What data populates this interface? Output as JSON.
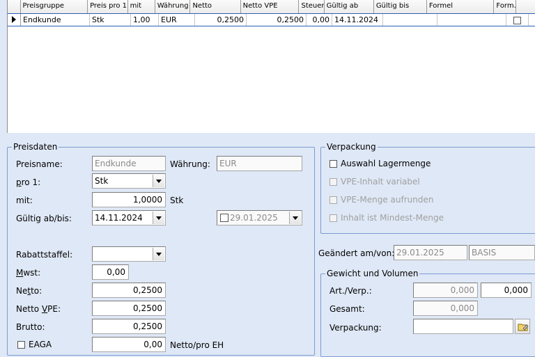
{
  "grid": {
    "headers": [
      "Preisgruppe",
      "Preis pro 1",
      "mit",
      "Währung",
      "Netto",
      "Netto VPE",
      "Steuer",
      "Gültig ab",
      "Gültig bis",
      "Formel",
      "Form."
    ],
    "row": {
      "preisgruppe": "Endkunde",
      "preis_pro": "Stk",
      "mit": "1,00",
      "waehrung": "EUR",
      "netto": "0,2500",
      "netto_vpe": "0,2500",
      "steuer": "0,00",
      "gueltig_ab": "14.11.2024",
      "gueltig_bis": "",
      "formel": "",
      "form_checked": false
    }
  },
  "preisdaten": {
    "title": "Preisdaten",
    "preisname_label": "Preisname:",
    "preisname_value": "Endkunde",
    "waehrung_label": "Währung:",
    "waehrung_value": "EUR",
    "pro1_label_u": "p",
    "pro1_label_rest": "ro 1:",
    "pro1_value": "Stk",
    "mit_label": "mit:",
    "mit_value": "1,0000",
    "mit_unit": "Stk",
    "gueltig_label": "Gültig ab/bis:",
    "gueltig_ab_value": "14.11.2024",
    "gueltig_bis_value": "29.01.2025",
    "rabatt_label": "Rabattstaffel:",
    "rabatt_value": "",
    "mwst_label_u": "M",
    "mwst_label_rest": "wst:",
    "mwst_value": "0,00",
    "netto_label_a": "Ne",
    "netto_label_u": "t",
    "netto_label_b": "to:",
    "netto_value": "0,2500",
    "nettovpe_label_a": "Netto ",
    "nettovpe_label_u": "V",
    "nettovpe_label_b": "PE:",
    "nettovpe_value": "0,2500",
    "brutto_label": "Brutto:",
    "brutto_value": "0,2500",
    "eaga_label": "EAGA",
    "eaga_value": "0,00",
    "eaga_unit": "Netto/pro EH"
  },
  "verpackung": {
    "title": "Verpackung",
    "options": [
      {
        "label": "Auswahl Lagermenge",
        "enabled": true
      },
      {
        "label": "VPE-Inhalt variabel",
        "enabled": false
      },
      {
        "label": "VPE-Menge aufrunden",
        "enabled": false
      },
      {
        "label": "Inhalt ist Mindest-Menge",
        "enabled": false
      }
    ]
  },
  "geaendert": {
    "label": "Geändert am/von:",
    "date": "29.01.2025",
    "user": "BASIS"
  },
  "gewicht": {
    "title": "Gewicht und Volumen",
    "art_label": "Art./Verp.:",
    "art_value1": "0,000",
    "art_value2": "0,000",
    "gesamt_label": "Gesamt:",
    "gesamt_value": "0,000",
    "verpackung_label": "Verpackung:",
    "verpackung_value": ""
  },
  "colors": {
    "background": "#dfe8f6",
    "group_border": "#7a9cd3",
    "selection_border": "#2b5fb8"
  }
}
